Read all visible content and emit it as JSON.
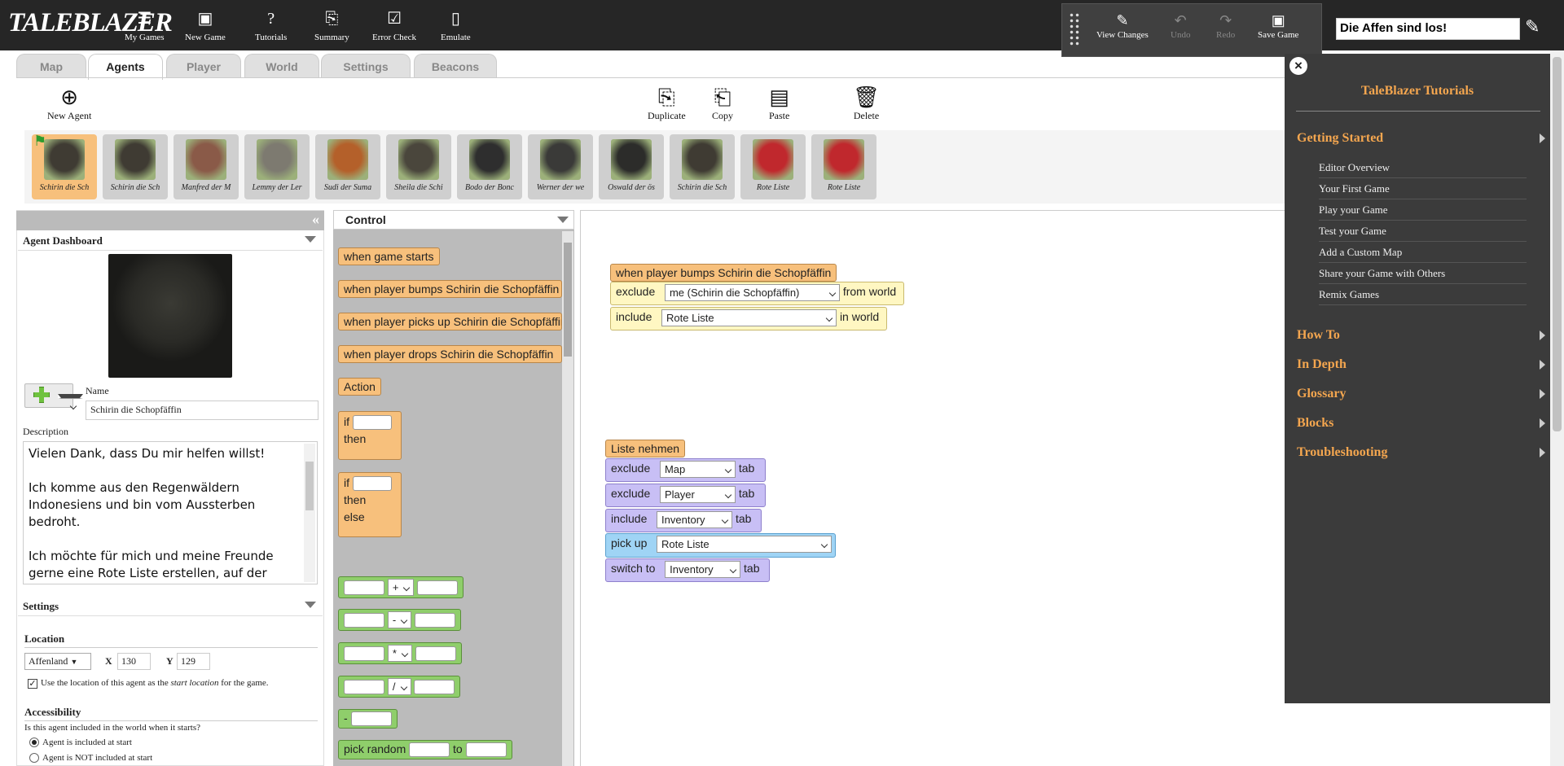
{
  "app": {
    "logo": "TALEBLAZER"
  },
  "toolbar": [
    {
      "name": "my-games-button",
      "label": "My Games",
      "icon": "list-icon",
      "glyph": "☰"
    },
    {
      "name": "new-game-button",
      "label": "New Game",
      "icon": "new-document-icon",
      "glyph": "▣"
    },
    {
      "name": "tutorials-button",
      "label": "Tutorials",
      "icon": "help-icon",
      "glyph": "?"
    },
    {
      "name": "summary-button",
      "label": "Summary",
      "icon": "summary-icon",
      "glyph": "⎘"
    },
    {
      "name": "error-check-button",
      "label": "Error Check",
      "icon": "checkbox-icon",
      "glyph": "☑"
    },
    {
      "name": "emulate-button",
      "label": "Emulate",
      "icon": "phone-icon",
      "glyph": "▯"
    }
  ],
  "gamepanel": {
    "view_changes": "View Changes",
    "undo": "Undo",
    "redo": "Redo",
    "save": "Save Game"
  },
  "game_name": "Die Affen sind los!",
  "tabs": [
    "Map",
    "Agents",
    "Player",
    "World",
    "Settings",
    "Beacons"
  ],
  "active_tab": "Agents",
  "actions": {
    "new_agent": "New Agent",
    "duplicate": "Duplicate",
    "copy": "Copy",
    "paste": "Paste",
    "delete": "Delete"
  },
  "agents": [
    {
      "name": "Schirin die Sch",
      "color": "#3f3b33"
    },
    {
      "name": "Schirin die Sch",
      "color": "#3f3b33"
    },
    {
      "name": "Manfred der M",
      "color": "#8a5a48"
    },
    {
      "name": "Lemmy der Ler",
      "color": "#7d7a70"
    },
    {
      "name": "Sudi der Suma",
      "color": "#b4602a"
    },
    {
      "name": "Sheila die Schi",
      "color": "#4a463c"
    },
    {
      "name": "Bodo der Bonc",
      "color": "#2e2e2e"
    },
    {
      "name": "Werner der we",
      "color": "#3a3a38"
    },
    {
      "name": "Oswald der ös",
      "color": "#2c2c2a"
    },
    {
      "name": "Schirin die Sch",
      "color": "#3f3b33"
    },
    {
      "name": "Rote Liste",
      "color": "#c0282d"
    },
    {
      "name": "Rote Liste",
      "color": "#c0282d"
    }
  ],
  "dashboard": {
    "title": "Agent Dashboard",
    "name_label": "Name",
    "name_value": "Schirin die Schopfäffin",
    "desc_label": "Description",
    "description": "Vielen Dank, dass Du mir helfen willst!\n\nIch komme aus den Regenwäldern Indonesiens und bin vom Aussterben bedroht.\n\nIch möchte für mich und meine Freunde gerne eine Rote Liste erstellen, auf der"
  },
  "settings": {
    "title": "Settings",
    "location_title": "Location",
    "region": "Affenland",
    "x_label": "X",
    "x_value": "130",
    "y_label": "Y",
    "y_value": "129",
    "start_text_before": "Use the location of this agent as the ",
    "start_text_em": "start location",
    "start_text_after": " for the game.",
    "accessibility_title": "Accessibility",
    "question": "Is this agent included in the world when it starts?",
    "option_included": "Agent is included at start",
    "option_not_included": "Agent is NOT included at start"
  },
  "palette": {
    "category": "Control",
    "blocks": {
      "when_game_starts": "when game starts",
      "when_bumps": "when player bumps Schirin die Schopfäffin",
      "when_picks_up": "when player picks up Schirin die Schopfäffin",
      "when_drops": "when player drops Schirin die Schopfäffin",
      "action": "Action",
      "if": "if",
      "then": "then",
      "else": "else",
      "op_plus": "+",
      "op_minus": "-",
      "op_times": "*",
      "op_div": "/",
      "neg": "-",
      "pick_random": "pick random",
      "to": "to"
    }
  },
  "workspace": {
    "event_block": {
      "title": "when player bumps Schirin die Schopfäffin",
      "exclude": "exclude",
      "exclude_value": "me (Schirin die Schopfäffin)",
      "from_world": "from world",
      "include": "include",
      "include_value": "Rote Liste",
      "in_world": "in world"
    },
    "liste_block": {
      "title": "Liste nehmen",
      "exclude": "exclude",
      "map_value": "Map",
      "player_value": "Player",
      "tab": "tab",
      "include": "include",
      "inventory_value": "Inventory",
      "pick_up": "pick up",
      "pick_up_value": "Rote Liste",
      "switch_to": "switch to",
      "switch_value": "Inventory"
    }
  },
  "tutorial": {
    "title": "TaleBlazer Tutorials",
    "getting_started": "Getting Started",
    "items": [
      "Editor Overview",
      "Your First Game",
      "Play your Game",
      "Test your Game",
      "Add a Custom Map",
      "Share your Game with Others",
      "Remix Games"
    ],
    "sections": [
      "How To",
      "In Depth",
      "Glossary",
      "Blocks",
      "Troubleshooting"
    ]
  },
  "colors": {
    "accent": "#f4a64f",
    "event_block": "#f7c07c",
    "math_block": "#8fce6b",
    "tab_block": "#c8bff5",
    "pickup_block": "#9fd4f5"
  }
}
